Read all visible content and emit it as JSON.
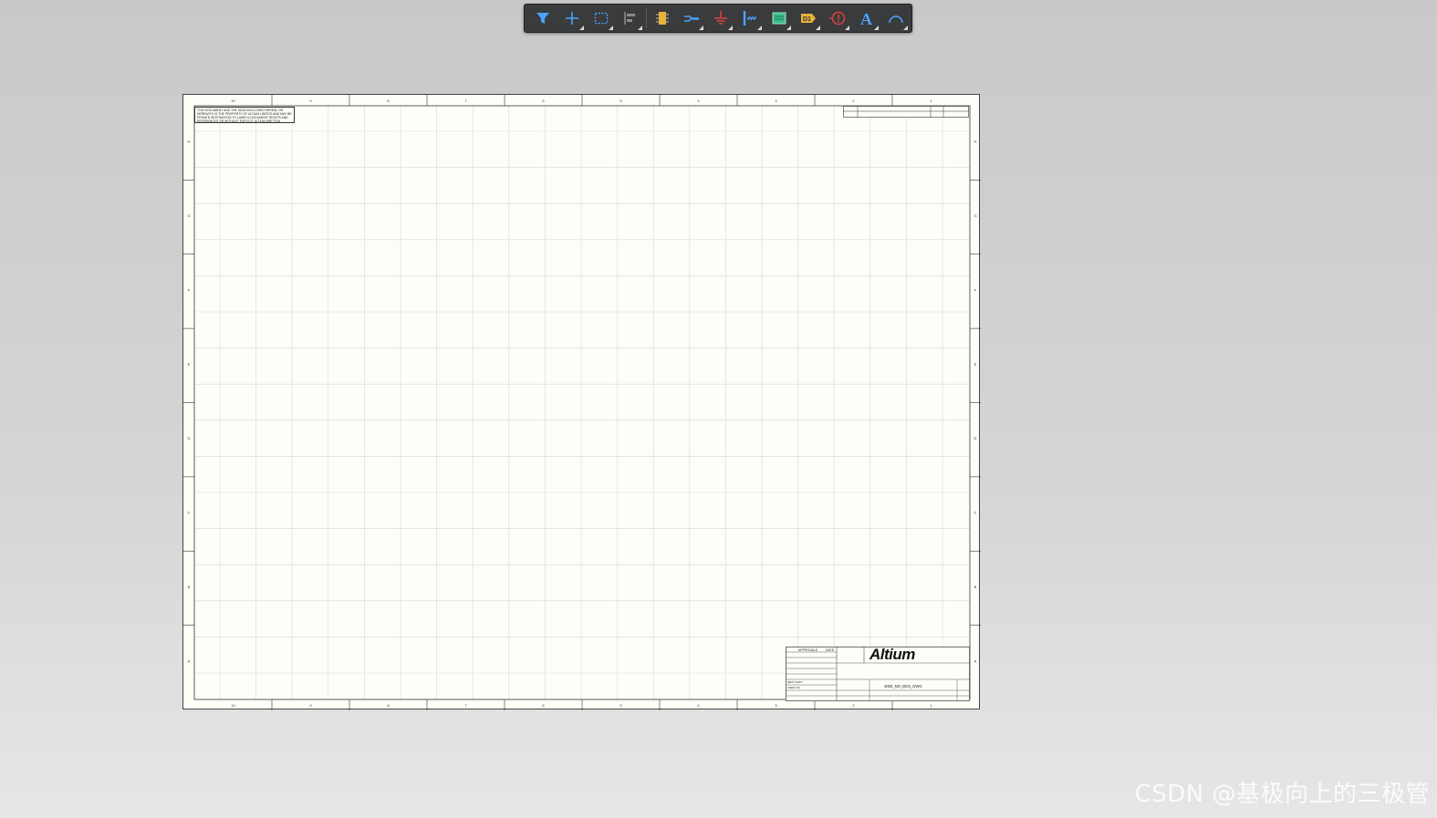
{
  "toolbar": {
    "items": [
      {
        "name": "filter-icon",
        "color": "#4aa3ff",
        "dropdown": false
      },
      {
        "name": "crosshair-icon",
        "color": "#4aa3ff",
        "dropdown": true
      },
      {
        "name": "select-rect-icon",
        "color": "#4aa3ff",
        "dropdown": true
      },
      {
        "name": "align-icon",
        "color": "#8a8a8a",
        "dropdown": true
      },
      {
        "name": "component-icon",
        "color": "#e8b23a",
        "dropdown": false
      },
      {
        "name": "wire-icon",
        "color": "#4aa3ff",
        "dropdown": true
      },
      {
        "name": "ground-power-icon",
        "color": "#e04040",
        "dropdown": true
      },
      {
        "name": "bus-icon",
        "color": "#4aa3ff",
        "dropdown": true
      },
      {
        "name": "sheet-symbol-icon",
        "color": "#3bbf8a",
        "dropdown": true
      },
      {
        "name": "port-icon",
        "color": "#e8b23a",
        "dropdown": true
      },
      {
        "name": "parameter-icon",
        "color": "#e04040",
        "dropdown": true
      },
      {
        "name": "text-icon",
        "color": "#4aa3ff",
        "dropdown": true
      },
      {
        "name": "arc-icon",
        "color": "#4aa3ff",
        "dropdown": true
      }
    ]
  },
  "sheet": {
    "top_zones": [
      "10",
      "9",
      "8",
      "7",
      "6",
      "5",
      "4",
      "3",
      "2",
      "1"
    ],
    "side_zones": [
      "H",
      "G",
      "F",
      "E",
      "D",
      "C",
      "B",
      "A"
    ],
    "notice": "THIS DOCUMENT AND THE DATA DISCLOSED HEREIN, OR HEREWITH IS THE PROPERTY OF ALTIUM LIMITED AND MAY BE PRIVATE DESTINATION TO LAWFUL DOCUMENT RIGHTS AND REFERENCES OR WITHOUT EXPLICIT ALTIUM WRITTEN"
  },
  "title_block": {
    "brand": "Altium",
    "approvals": "APPROVALS",
    "date": "DATE",
    "drawing_no": "4000_NO_BGS_DWG",
    "next_assy": "NEXT ASSY",
    "used_on": "USED ON"
  },
  "watermark": "CSDN @基极向上的三极管"
}
